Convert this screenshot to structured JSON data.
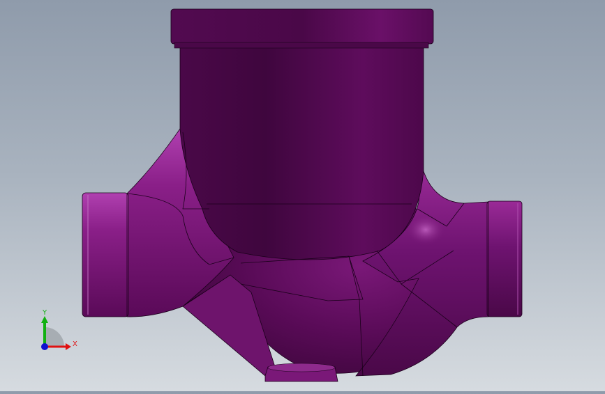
{
  "window": {
    "title": ""
  },
  "model": {
    "name_icon": "valve-body-model",
    "color": "#5e0a5c",
    "highlight": "#9a2a97",
    "shadow": "#3e053d"
  },
  "triad": {
    "x_label": "X",
    "y_label": "Y",
    "x_color": "#e01010",
    "y_color": "#10b010",
    "z_color": "#1010d0"
  }
}
